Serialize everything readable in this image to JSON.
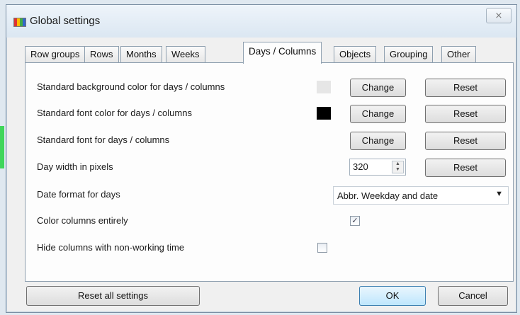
{
  "window": {
    "title": "Global settings",
    "close_glyph": "⨯",
    "icon": "app-logo-icon"
  },
  "tabs": [
    {
      "label": "Row groups",
      "active": false
    },
    {
      "label": "Rows",
      "active": false
    },
    {
      "label": "Months",
      "active": false
    },
    {
      "label": "Weeks",
      "active": false
    },
    {
      "label": "Days / Columns",
      "active": true
    },
    {
      "label": "Objects",
      "active": false
    },
    {
      "label": "Grouping",
      "active": false
    },
    {
      "label": "Other",
      "active": false
    }
  ],
  "settings": {
    "bg_color": {
      "label": "Standard background color for days / columns",
      "swatch_color": "#e6e6e6",
      "change_label": "Change",
      "reset_label": "Reset"
    },
    "font_color": {
      "label": "Standard font color for days / columns",
      "swatch_color": "#000000",
      "change_label": "Change",
      "reset_label": "Reset"
    },
    "font": {
      "label": "Standard font for days / columns",
      "change_label": "Change",
      "reset_label": "Reset"
    },
    "day_width": {
      "label": "Day width in pixels",
      "value": "320",
      "reset_label": "Reset"
    },
    "date_format": {
      "label": "Date format for days",
      "selected": "Abbr. Weekday and date"
    },
    "color_columns": {
      "label": "Color columns entirely",
      "checked": true,
      "check_glyph": "✓"
    },
    "hide_nonworking": {
      "label": "Hide columns with non-working time",
      "checked": false
    }
  },
  "footer": {
    "reset_all_label": "Reset all settings",
    "ok_label": "OK",
    "cancel_label": "Cancel"
  }
}
